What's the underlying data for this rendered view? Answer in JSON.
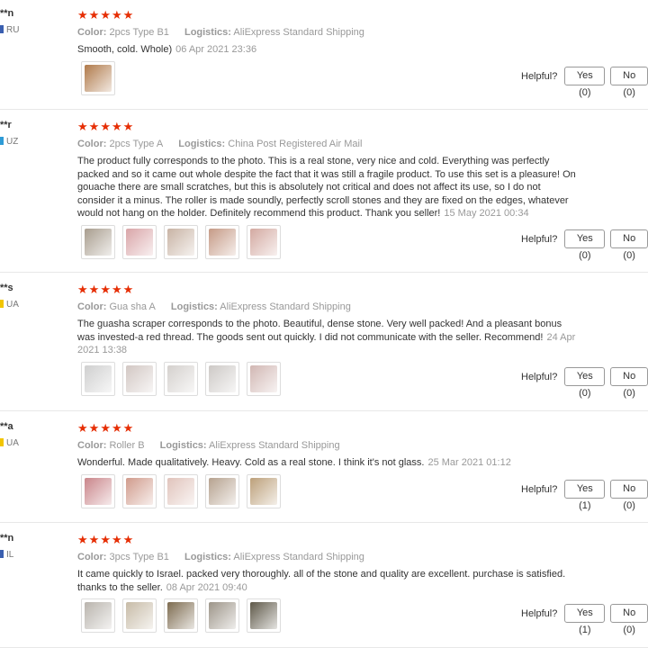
{
  "reviews": [
    {
      "name": "**n",
      "country": "RU",
      "flag_color": "#3a5fb0",
      "rating": 5,
      "color_label": "Color:",
      "color": "2pcs Type B1",
      "logistics_label": "Logistics:",
      "logistics": "AliExpress Standard Shipping",
      "text": "Smooth, cold. Whole)",
      "date": "06 Apr 2021 23:36",
      "photos": [
        "#b07a4a"
      ],
      "helpful": "Helpful?",
      "yes": "Yes (0)",
      "no": "No (0)"
    },
    {
      "name": "**r",
      "country": "UZ",
      "flag_color": "#2e9bd6",
      "rating": 5,
      "color_label": "Color:",
      "color": "2pcs Type A",
      "logistics_label": "Logistics:",
      "logistics": "China Post Registered Air Mail",
      "text": "The product fully corresponds to the photo. This is a real stone, very nice and cold. Everything was perfectly packed and so it came out whole despite the fact that it was still a fragile product. To use this set is a pleasure! On gouache there are small scratches, but this is absolutely not critical and does not affect its use, so I do not consider it a minus. The roller is made soundly, perfectly scroll stones and they are fixed on the edges, whatever would not hang on the holder. Definitely recommend this product. Thank you seller!",
      "date": "15 May 2021 00:34",
      "photos": [
        "#a89d8e",
        "#d9a5a8",
        "#c8b3a4",
        "#c59a86",
        "#d3a9a1"
      ],
      "helpful": "Helpful?",
      "yes": "Yes (0)",
      "no": "No (0)"
    },
    {
      "name": "**s",
      "country": "UA",
      "flag_color": "#f2c500",
      "rating": 5,
      "color_label": "Color:",
      "color": "Gua sha A",
      "logistics_label": "Logistics:",
      "logistics": "AliExpress Standard Shipping",
      "text": "The guasha scraper corresponds to the photo. Beautiful, dense stone. Very well packed! And a pleasant bonus was invested-a red thread. The goods sent out quickly. I did not communicate with the seller. Recommend!",
      "date": "24 Apr 2021 13:38",
      "photos": [
        "#cfcfcf",
        "#d2c7c3",
        "#d4d0cd",
        "#cdc9c6",
        "#d1b7b3"
      ],
      "helpful": "Helpful?",
      "yes": "Yes (0)",
      "no": "No (0)"
    },
    {
      "name": "**a",
      "country": "UA",
      "flag_color": "#f2c500",
      "rating": 5,
      "color_label": "Color:",
      "color": "Roller B",
      "logistics_label": "Logistics:",
      "logistics": "AliExpress Standard Shipping",
      "text": "Wonderful. Made qualitatively. Heavy. Cold as a real stone. I think it's not glass.",
      "date": "25 Mar 2021 01:12",
      "photos": [
        "#c9858a",
        "#d09b8c",
        "#e0c3bb",
        "#b6a28f",
        "#bca07a"
      ],
      "helpful": "Helpful?",
      "yes": "Yes (1)",
      "no": "No (0)"
    },
    {
      "name": "**n",
      "country": "IL",
      "flag_color": "#3a5fb0",
      "rating": 5,
      "color_label": "Color:",
      "color": "3pcs Type B1",
      "logistics_label": "Logistics:",
      "logistics": "AliExpress Standard Shipping",
      "text": "It came quickly to Israel. packed very thoroughly. all of the stone and quality are excellent. purchase is satisfied. thanks to the seller.",
      "date": "08 Apr 2021 09:40",
      "photos": [
        "#b9b4ad",
        "#c7bba7",
        "#7d6b4f",
        "#9d9589",
        "#5e5848"
      ],
      "helpful": "Helpful?",
      "yes": "Yes (1)",
      "no": "No (0)"
    }
  ]
}
